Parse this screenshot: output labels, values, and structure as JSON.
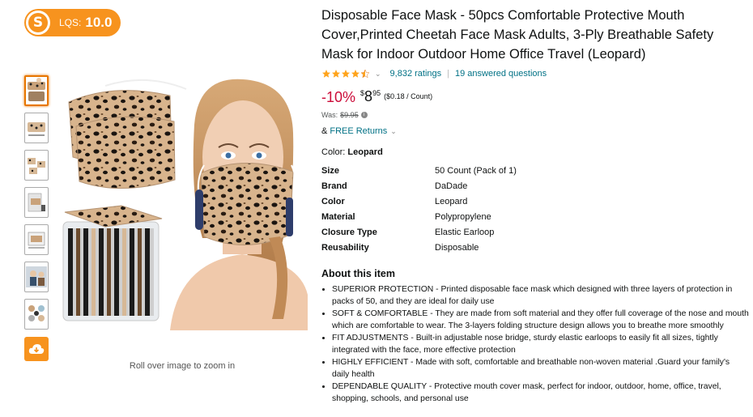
{
  "lqs_badge": {
    "label": "LQS:",
    "score": "10.0"
  },
  "gallery": {
    "thumbnails": [
      "mask-stack",
      "mask-flat",
      "mask-pattern",
      "mask-box",
      "mask-size-chart",
      "mask-lifestyle",
      "mask-collage"
    ],
    "zoom_hint": "Roll over image to zoom in"
  },
  "product": {
    "title": "Disposable Face Mask - 50pcs Comfortable Protective Mouth Cover,Printed Cheetah Face Mask Adults, 3-Ply Breathable Safety Mask for Indoor Outdoor Home Office Travel (Leopard)",
    "rating_stars": 4.5,
    "ratings_text": "9,832 ratings",
    "separator": "|",
    "questions_text": "19 answered questions",
    "discount": "-10%",
    "price_symbol": "$",
    "price_whole": "8",
    "price_fraction": "95",
    "price_per_unit": "($0.18 / Count)",
    "was_label": "Was:",
    "was_price": "$9.95",
    "returns_prefix": "&",
    "returns_text": "FREE Returns",
    "color_label": "Color:",
    "color_value": "Leopard"
  },
  "specs": [
    {
      "key": "Size",
      "value": "50 Count (Pack of 1)"
    },
    {
      "key": "Brand",
      "value": "DaDade"
    },
    {
      "key": "Color",
      "value": "Leopard"
    },
    {
      "key": "Material",
      "value": "Polypropylene"
    },
    {
      "key": "Closure Type",
      "value": "Elastic Earloop"
    },
    {
      "key": "Reusability",
      "value": "Disposable"
    }
  ],
  "about": {
    "title": "About this item",
    "bullets": [
      "SUPERIOR PROTECTION - Printed disposable face mask which designed with three layers of protection in packs of 50, and they are ideal for daily use",
      "SOFT & COMFORTABLE - They are made from soft material and they offer full coverage of the nose and mouth which are comfortable to wear. The 3-layers folding structure design allows you to breathe more smoothly",
      "FIT ADJUSTMENTS - Built-in adjustable nose bridge, sturdy elastic earloops to easily fit all sizes, tightly integrated with the face, more effective protection",
      "HIGHLY EFFICIENT - Made with soft, comfortable and breathable non-woven material .Guard your family's daily health",
      "DEPENDABLE QUALITY - Protective mouth cover mask, perfect for indoor, outdoor, home, office, travel, shopping, schools, and personal use"
    ]
  },
  "colors": {
    "accent": "#f7931e",
    "link": "#007185",
    "discount": "#cc0c39",
    "star": "#ffa41c"
  }
}
